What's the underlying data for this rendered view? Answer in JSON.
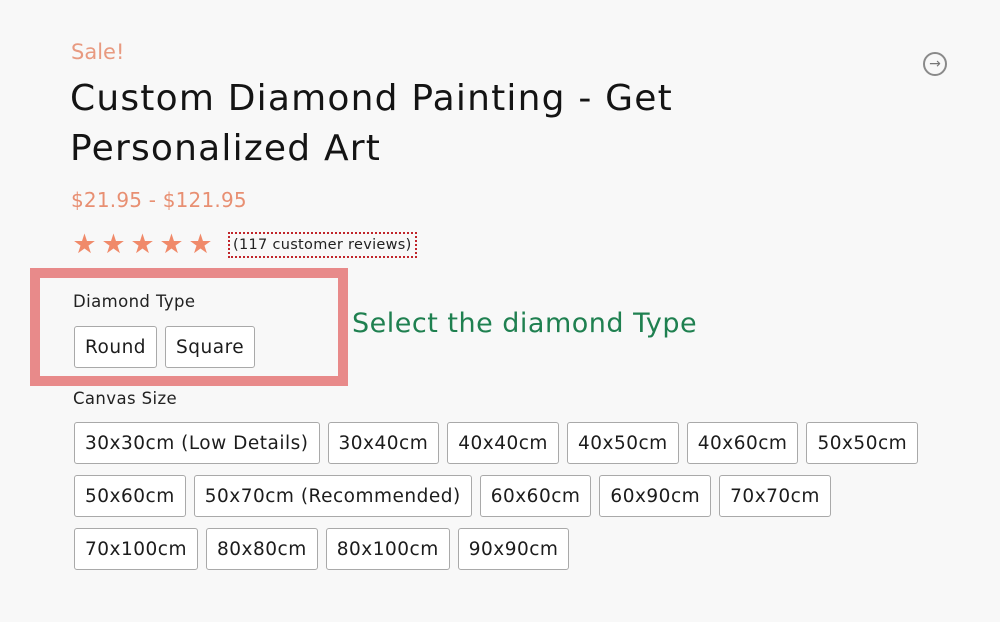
{
  "product": {
    "sale_badge": "Sale!",
    "title": "Custom Diamond Painting - Get Personalized Art",
    "price_range": "$21.95 - $121.95",
    "rating": {
      "stars": 5,
      "max_stars": 5,
      "star_glyph": "★"
    },
    "reviews_link": "(117 customer reviews)",
    "next_icon": "arrow-right-circle-icon"
  },
  "diamond_type": {
    "label": "Diamond Type",
    "options": [
      "Round",
      "Square"
    ]
  },
  "annotation": {
    "text": "Select the diamond Type",
    "color": "#1f8050",
    "highlight_color": "#e88a8a"
  },
  "canvas_size": {
    "label": "Canvas Size",
    "rows": [
      [
        "30x30cm (Low Details)",
        "30x40cm",
        "40x40cm",
        "40x50cm",
        "40x60cm",
        "50x50cm"
      ],
      [
        "50x60cm",
        "50x70cm (Recommended)",
        "60x60cm",
        "60x90cm",
        "70x70cm"
      ],
      [
        "70x100cm",
        "80x80cm",
        "80x100cm",
        "90x90cm"
      ]
    ]
  },
  "colors": {
    "accent": "#e88f72",
    "star": "#f08a6a",
    "review_border": "#c0262b"
  }
}
